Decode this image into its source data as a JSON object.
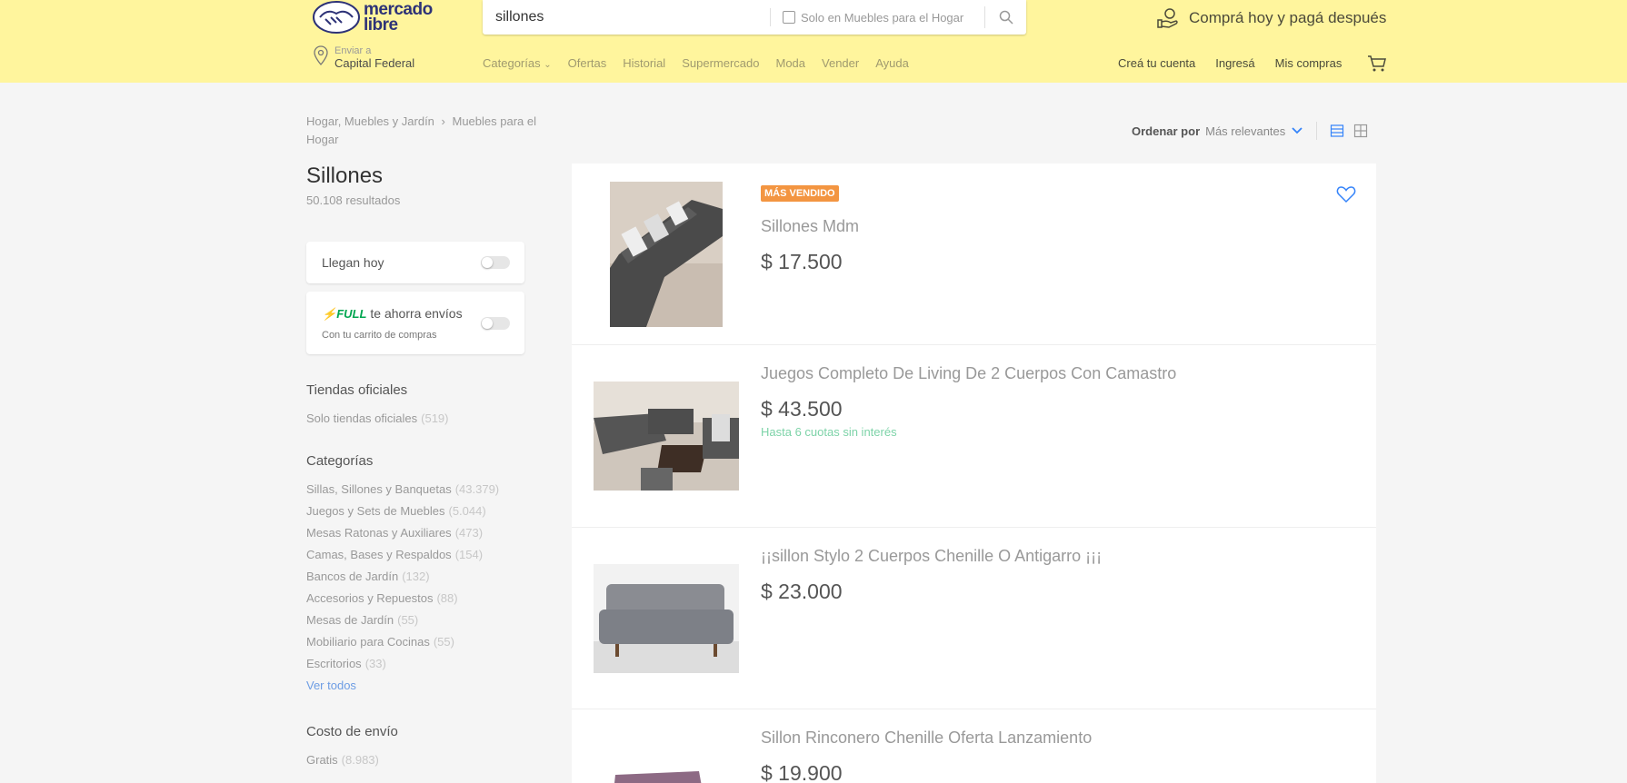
{
  "header": {
    "logo_line1": "mercado",
    "logo_line2": "libre",
    "search_value": "sillones",
    "search_filter_label": "Solo en Muebles para el Hogar",
    "promo_text": "Comprá hoy y pagá después",
    "location_label": "Enviar a",
    "location_value": "Capital Federal",
    "nav": [
      "Categorías",
      "Ofertas",
      "Historial",
      "Supermercado",
      "Moda",
      "Vender",
      "Ayuda"
    ],
    "user_links": [
      "Creá tu cuenta",
      "Ingresá",
      "Mis compras"
    ]
  },
  "breadcrumb": {
    "items": [
      "Hogar, Muebles y Jardín",
      "Muebles para el Hogar"
    ]
  },
  "page": {
    "title": "Sillones",
    "results_count": "50.108 resultados"
  },
  "filters": {
    "arrive_today": "Llegan hoy",
    "full_tag": "FULL",
    "full_text": "te ahorra envíos",
    "full_sub": "Con tu carrito de compras"
  },
  "official_stores": {
    "title": "Tiendas oficiales",
    "items": [
      {
        "label": "Solo tiendas oficiales",
        "count": "(519)"
      }
    ]
  },
  "categories": {
    "title": "Categorías",
    "items": [
      {
        "label": "Sillas, Sillones y Banquetas",
        "count": "(43.379)"
      },
      {
        "label": "Juegos y Sets de Muebles",
        "count": "(5.044)"
      },
      {
        "label": "Mesas Ratonas y Auxiliares",
        "count": "(473)"
      },
      {
        "label": "Camas, Bases y Respaldos",
        "count": "(154)"
      },
      {
        "label": "Bancos de Jardín",
        "count": "(132)"
      },
      {
        "label": "Accesorios y Repuestos",
        "count": "(88)"
      },
      {
        "label": "Mesas de Jardín",
        "count": "(55)"
      },
      {
        "label": "Mobiliario para Cocinas",
        "count": "(55)"
      },
      {
        "label": "Escritorios",
        "count": "(33)"
      }
    ],
    "see_all": "Ver todos"
  },
  "shipping": {
    "title": "Costo de envío",
    "items": [
      {
        "label": "Gratis",
        "count": "(8.983)"
      }
    ]
  },
  "sort": {
    "label": "Ordenar por",
    "value": "Más relevantes"
  },
  "items": [
    {
      "badge": "MÁS VENDIDO",
      "title": "Sillones Mdm",
      "price": "$ 17.500",
      "installments": ""
    },
    {
      "badge": "",
      "title": "Juegos Completo De Living De 2 Cuerpos Con Camastro",
      "price": "$ 43.500",
      "installments": "Hasta 6 cuotas sin interés"
    },
    {
      "badge": "",
      "title": "¡¡sillon Stylo 2 Cuerpos Chenille O Antigarro ¡¡¡",
      "price": "$ 23.000",
      "installments": ""
    },
    {
      "badge": "",
      "title": "Sillon Rinconero Chenille Oferta Lanzamiento",
      "price": "$ 19.900",
      "installments": ""
    }
  ]
}
